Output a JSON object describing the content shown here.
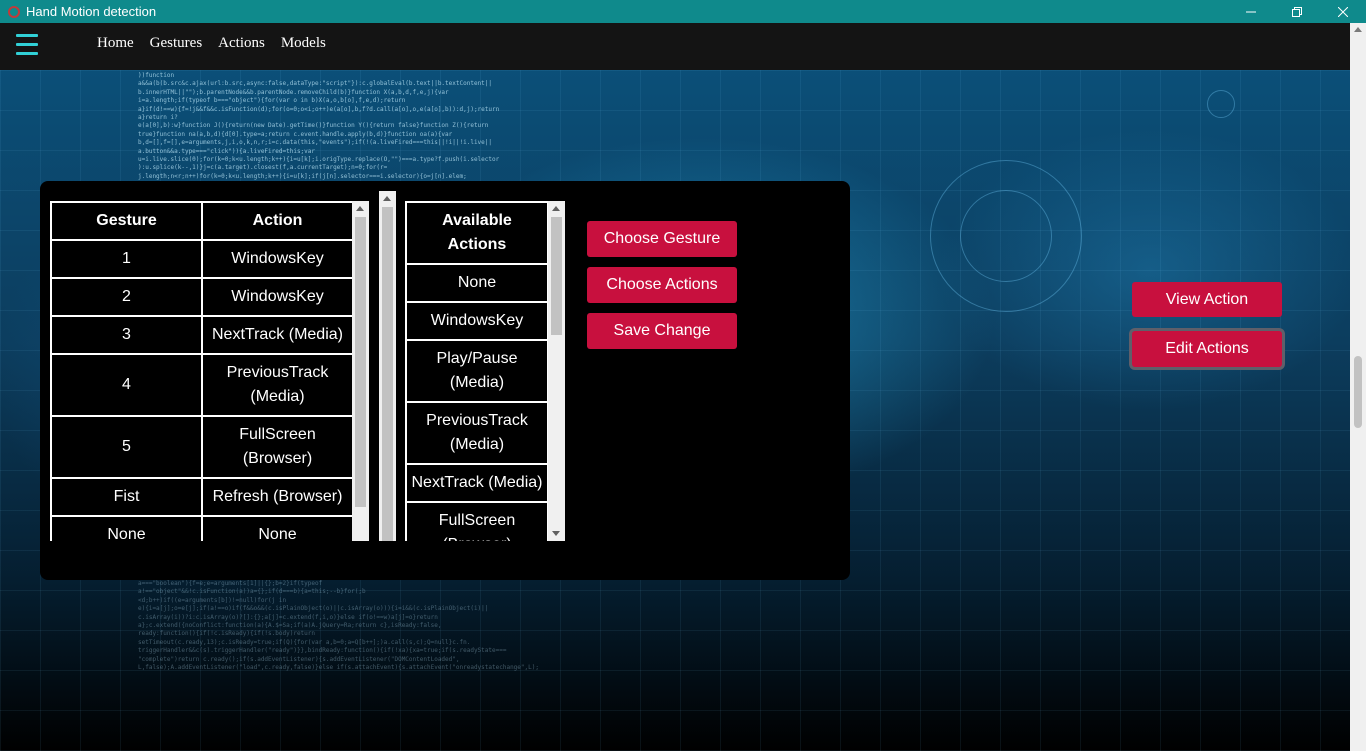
{
  "window": {
    "title": "Hand Motion detection",
    "controls": [
      "minimize-icon",
      "restore-icon",
      "close-icon"
    ]
  },
  "nav": {
    "menu_icon": "hamburger-icon",
    "links": [
      "Home",
      "Gestures",
      "Actions",
      "Models"
    ]
  },
  "gesture_table": {
    "headers": [
      "Gesture",
      "Action"
    ],
    "rows": [
      [
        "1",
        "WindowsKey"
      ],
      [
        "2",
        "WindowsKey"
      ],
      [
        "3",
        "NextTrack (Media)"
      ],
      [
        "4",
        "PreviousTrack (Media)"
      ],
      [
        "5",
        "FullScreen (Browser)"
      ],
      [
        "Fist",
        "Refresh (Browser)"
      ],
      [
        "None",
        "None"
      ]
    ]
  },
  "available_actions": {
    "header": "Available Actions",
    "items": [
      "None",
      "WindowsKey",
      "Play/Pause (Media)",
      "PreviousTrack (Media)",
      "NextTrack (Media)",
      "FullScreen (Browser)"
    ]
  },
  "buttons": {
    "choose_gesture": "Choose Gesture",
    "choose_actions": "Choose Actions",
    "save_change": "Save Change",
    "view_action": "View Action",
    "edit_actions": "Edit Actions"
  },
  "colors": {
    "titlebar": "#0f8a8c",
    "accent_button": "#c8103e",
    "hamburger": "#31d0d6"
  }
}
